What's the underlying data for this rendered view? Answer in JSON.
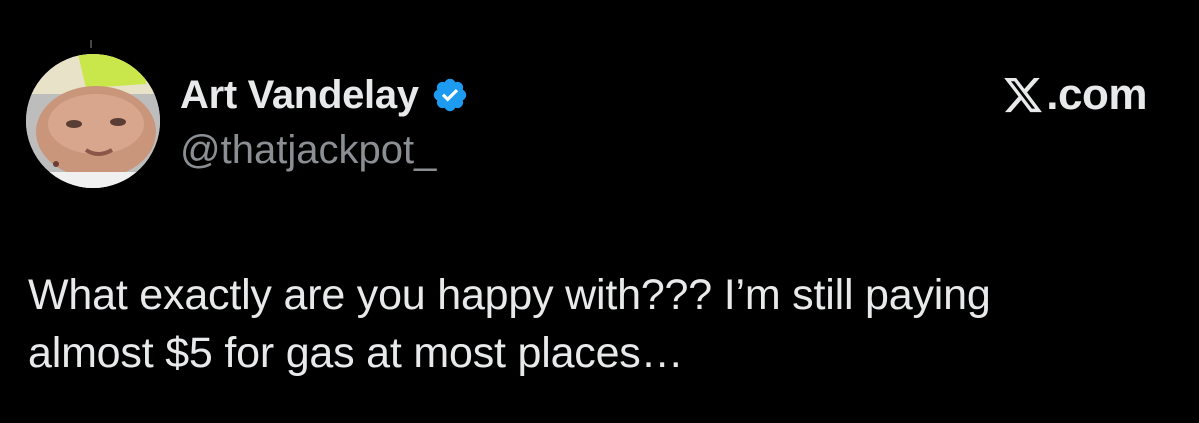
{
  "user": {
    "display_name": "Art Vandelay",
    "handle": "@thatjackpot_",
    "verified_icon": "verified-badge-icon",
    "verified_color": "#1d9bf0"
  },
  "brand": {
    "icon": "x-logo-icon",
    "domain_text": ".com"
  },
  "tweet": {
    "text": "What exactly are you happy with??? I’m still paying\nalmost $5 for gas at most places…"
  },
  "colors": {
    "background": "#000000",
    "primary_text": "#e7e9ea",
    "secondary_text": "#8b8f94"
  }
}
